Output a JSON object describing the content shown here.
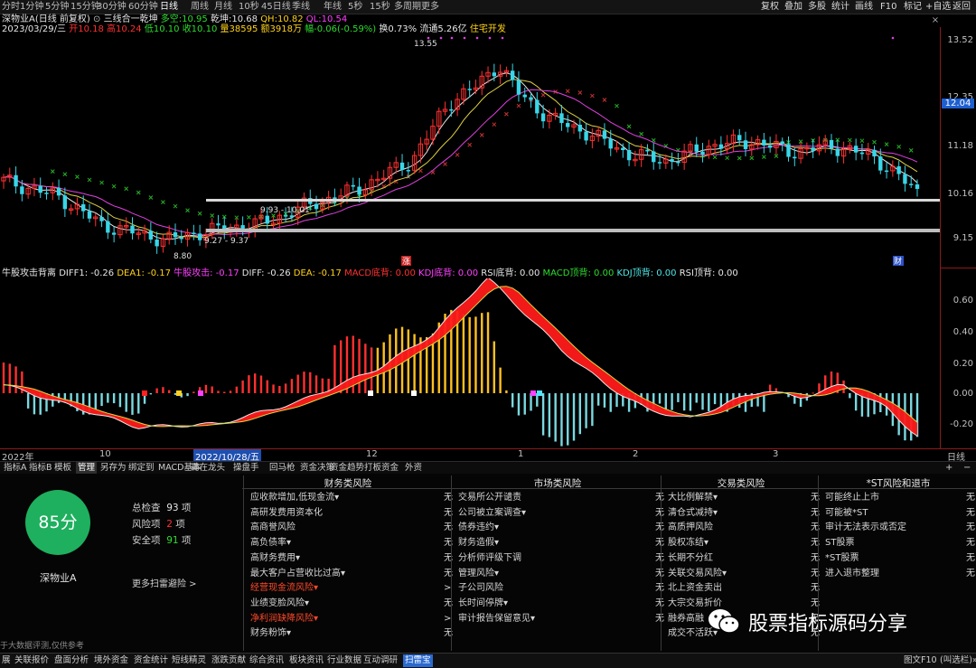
{
  "toolbar": {
    "periods": [
      "分时",
      "1分钟",
      "5分钟",
      "15分钟",
      "30分钟",
      "60分钟",
      "日线",
      "周线",
      "月线",
      "10秒",
      "45日线",
      "季线",
      "年线",
      "5秒",
      "15秒",
      "多周期",
      "更多"
    ],
    "active_period": "日线",
    "right_buttons": [
      "复权",
      "叠加",
      "多股",
      "统计",
      "画线",
      "F10",
      "标记",
      "+自选",
      "返回"
    ]
  },
  "info1": {
    "stock": "深物业A(日线 前复权)",
    "indicator": "三线合一乾坤",
    "duokong_label": "多空:",
    "duokong_value": "10.95",
    "qiankun_label": "乾坤:",
    "qiankun_value": "10.68",
    "qh_label": "QH:",
    "qh_value": "10.82",
    "ql_label": "QL:",
    "ql_value": "10.54"
  },
  "info2": {
    "date": "2023/03/29/三",
    "open": "开10.18",
    "high": "高10.24",
    "low": "低10.10",
    "close": "收10.10",
    "volume": "量38595",
    "amount": "额3918万",
    "change": "幅-0.06(-0.59%)",
    "turnover": "换0.73%",
    "float": "流通5.26亿",
    "note": "住宅开发"
  },
  "main_axis": [
    "13.52",
    "12.35",
    "11.18",
    "10.16",
    "9.15"
  ],
  "current_price_tag": "12.04",
  "annotations": {
    "high": "13.55",
    "low": "8.80",
    "range1": "9.93 - 10.01",
    "range2": "9.27 - 9.37",
    "zhang": "涨",
    "cai": "财"
  },
  "sub_info": {
    "name": "牛股攻击背离",
    "diff1": "DIFF1: -0.26",
    "dea1": "DEA1: -0.17",
    "gongji": "牛股攻击: -0.17",
    "diff": "DIFF: -0.26",
    "dea": "DEA: -0.17",
    "macd_di": "MACD底背: 0.00",
    "kdj_di": "KDJ底背: 0.00",
    "rsi_di": "RSI底背: 0.00",
    "macd_ding": "MACD顶背: 0.00",
    "kdj_ding": "KDJ顶背: 0.00",
    "rsi_ding": "RSI顶背: 0.00"
  },
  "sub_axis": [
    "0.60",
    "0.40",
    "0.20",
    "0.00",
    "-0.20"
  ],
  "time_axis": {
    "year": "2022年",
    "m10": "10",
    "cursor_date": "2022/10/28/五",
    "m12": "12",
    "m1": "1",
    "m2": "2",
    "m3": "3",
    "period": "日线"
  },
  "tabs": [
    "指标A",
    "指标B",
    "模板",
    "管理",
    "另存为",
    "绑定到",
    "MACD基本",
    "霸在龙头",
    "操盘手",
    "回马枪",
    "资金决策",
    "资金趋势",
    "打板资金",
    "外资"
  ],
  "active_tab": "管理",
  "risk": {
    "score": "85分",
    "total_label": "总检查",
    "total_value": "93",
    "total_unit": "项",
    "risk_label": "风险项",
    "risk_value": "2",
    "risk_unit": "项",
    "safe_label": "安全项",
    "safe_value": "91",
    "safe_unit": "项",
    "stock_name": "深物业A",
    "more_link": "更多扫雷避险 >",
    "disclaimer": "于大数据评测,仅供参考",
    "columns": [
      {
        "title": "财务类风险",
        "items": [
          {
            "label": "应收款增加,低现金流▾",
            "value": "无",
            "hot": false
          },
          {
            "label": "高研发费用资本化",
            "value": "无",
            "hot": false
          },
          {
            "label": "高商誉风险",
            "value": "无",
            "hot": false
          },
          {
            "label": "高负债率▾",
            "value": "无",
            "hot": false
          },
          {
            "label": "高财务费用▾",
            "value": "无",
            "hot": false
          },
          {
            "label": "最大客户占营收比过高▾",
            "value": "无",
            "hot": false
          },
          {
            "label": "经营现金流风险▾",
            "value": ">",
            "hot": true
          },
          {
            "label": "业绩变脸风险▾",
            "value": "无",
            "hot": false
          },
          {
            "label": "净利润缺降风险▾",
            "value": ">",
            "hot": true
          },
          {
            "label": "财务粉饰▾",
            "value": "无",
            "hot": false
          }
        ]
      },
      {
        "title": "市场类风险",
        "items": [
          {
            "label": "交易所公开谴责",
            "value": "无",
            "hot": false
          },
          {
            "label": "公司被立案调查▾",
            "value": "无",
            "hot": false
          },
          {
            "label": "债券违约▾",
            "value": "无",
            "hot": false
          },
          {
            "label": "财务造假▾",
            "value": "无",
            "hot": false
          },
          {
            "label": "分析师评级下调",
            "value": "无",
            "hot": false
          },
          {
            "label": "管理风险▾",
            "value": "无",
            "hot": false
          },
          {
            "label": "子公司风险",
            "value": "无",
            "hot": false
          },
          {
            "label": "长时间停牌▾",
            "value": "无",
            "hot": false
          },
          {
            "label": "审计报告保留意见▾",
            "value": "无",
            "hot": false
          }
        ]
      },
      {
        "title": "交易类风险",
        "items": [
          {
            "label": "大比例解禁▾",
            "value": "无",
            "hot": false
          },
          {
            "label": "清仓式减持▾",
            "value": "无",
            "hot": false
          },
          {
            "label": "高质押风险",
            "value": "无",
            "hot": false
          },
          {
            "label": "股权冻结▾",
            "value": "无",
            "hot": false
          },
          {
            "label": "长期不分红",
            "value": "无",
            "hot": false
          },
          {
            "label": "关联交易风险▾",
            "value": "无",
            "hot": false
          },
          {
            "label": "北上资金卖出",
            "value": "无",
            "hot": false
          },
          {
            "label": "大宗交易折价",
            "value": "无",
            "hot": false
          },
          {
            "label": "融券高融",
            "value": "无",
            "hot": false
          },
          {
            "label": "成交不活跃▾",
            "value": "无",
            "hot": false
          }
        ]
      },
      {
        "title": "*ST风险和退市",
        "items": [
          {
            "label": "可能终止上市",
            "value": "无",
            "hot": false
          },
          {
            "label": "可能被*ST",
            "value": "无",
            "hot": false
          },
          {
            "label": "审计无法表示或否定",
            "value": "无",
            "hot": false
          },
          {
            "label": "ST股票",
            "value": "无",
            "hot": false
          },
          {
            "label": "*ST股票",
            "value": "无",
            "hot": false
          },
          {
            "label": "进入退市整理",
            "value": "无",
            "hot": false
          }
        ]
      }
    ]
  },
  "watermark": "股票指标源码分享",
  "bottom": {
    "items": [
      "展",
      "关联报价",
      "盘面分析",
      "境外资金",
      "资金统计",
      "短线精灵",
      "涨跌贡献",
      "综合资讯",
      "板块资讯",
      "行业数据",
      "互动调研",
      "扫雷宝"
    ],
    "active": "扫雷宝",
    "right_label": "图文F10",
    "right2": "(叫选栏)»"
  },
  "colors": {
    "up": "#ff3030",
    "down": "#38d6e8",
    "ma_short": "#e8e8e8",
    "ma_yellow": "#e0d040",
    "ma_magenta": "#e040e0",
    "sar": "#26b026",
    "sar_red": "#c83232"
  }
}
